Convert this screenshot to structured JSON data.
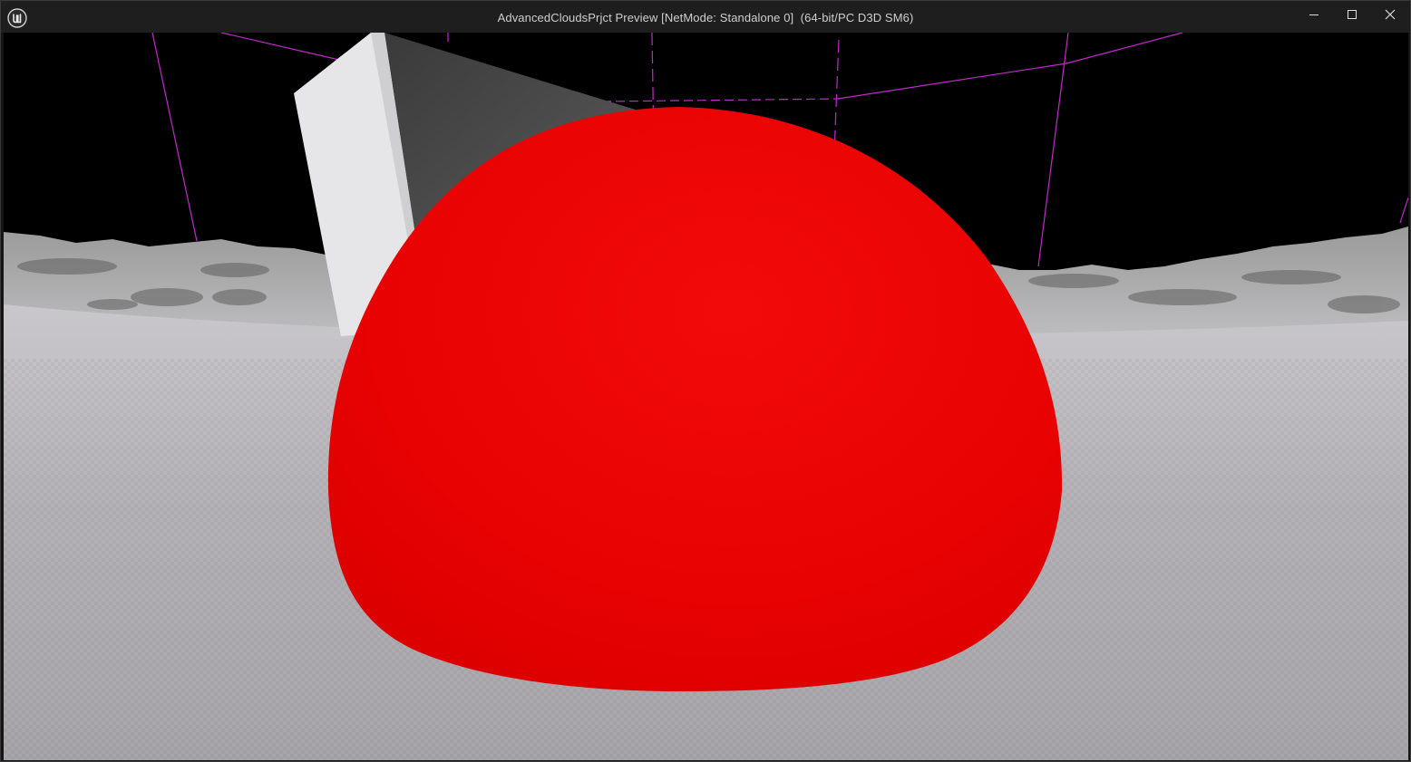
{
  "window": {
    "title": "AdvancedCloudsPrjct Preview [NetMode: Standalone 0]  (64-bit/PC D3D SM6)",
    "logo_icon": "unreal-engine-logo-icon",
    "controls": {
      "minimize_icon": "minimize-icon",
      "maximize_icon": "maximize-icon",
      "close_icon": "close-icon"
    }
  },
  "scene": {
    "sky_color": "#000000",
    "ground_color": "#b9b7bb",
    "hemisphere_color": "#ee0000",
    "debug_line_color": "#c02ac8",
    "cube_light_face": "#e6e6e8",
    "cube_dark_face": "#4a4a4a"
  }
}
